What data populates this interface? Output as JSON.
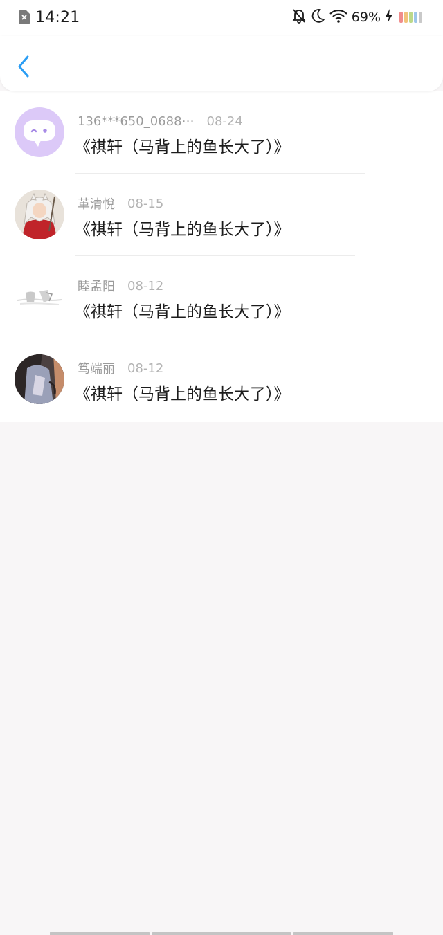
{
  "status_bar": {
    "time": "14:21",
    "battery_percent": "69%",
    "icons": [
      "sim-error-icon",
      "bell-off-icon",
      "moon-icon",
      "wifi-icon",
      "charging-icon",
      "battery-icon"
    ]
  },
  "header": {
    "back_icon": "chevron-left-icon",
    "accent_color": "#2a9df4"
  },
  "list": {
    "items": [
      {
        "name": "136***650_0688⋯",
        "date": "08-24",
        "title": "《祺轩（马背上的鱼长大了）》",
        "avatar": "chat-bubble-avatar"
      },
      {
        "name": "革清悅",
        "date": "08-15",
        "title": "《祺轩（马背上的鱼长大了）》",
        "avatar": "anime-character-avatar"
      },
      {
        "name": "睦孟阳",
        "date": "08-12",
        "title": "《祺轩（马背上的鱼长大了）》",
        "avatar": "sketch-avatar"
      },
      {
        "name": "笃端丽",
        "date": "08-12",
        "title": "《祺轩（马背上的鱼长大了）》",
        "avatar": "photo-avatar"
      }
    ]
  },
  "colors": {
    "background": "#f8f6f7",
    "card": "#ffffff",
    "name_text": "#9b9b9b",
    "date_text": "#b3b3b3",
    "title_text": "#1c1c1c",
    "avatar_purple": "#d9c6f7"
  }
}
